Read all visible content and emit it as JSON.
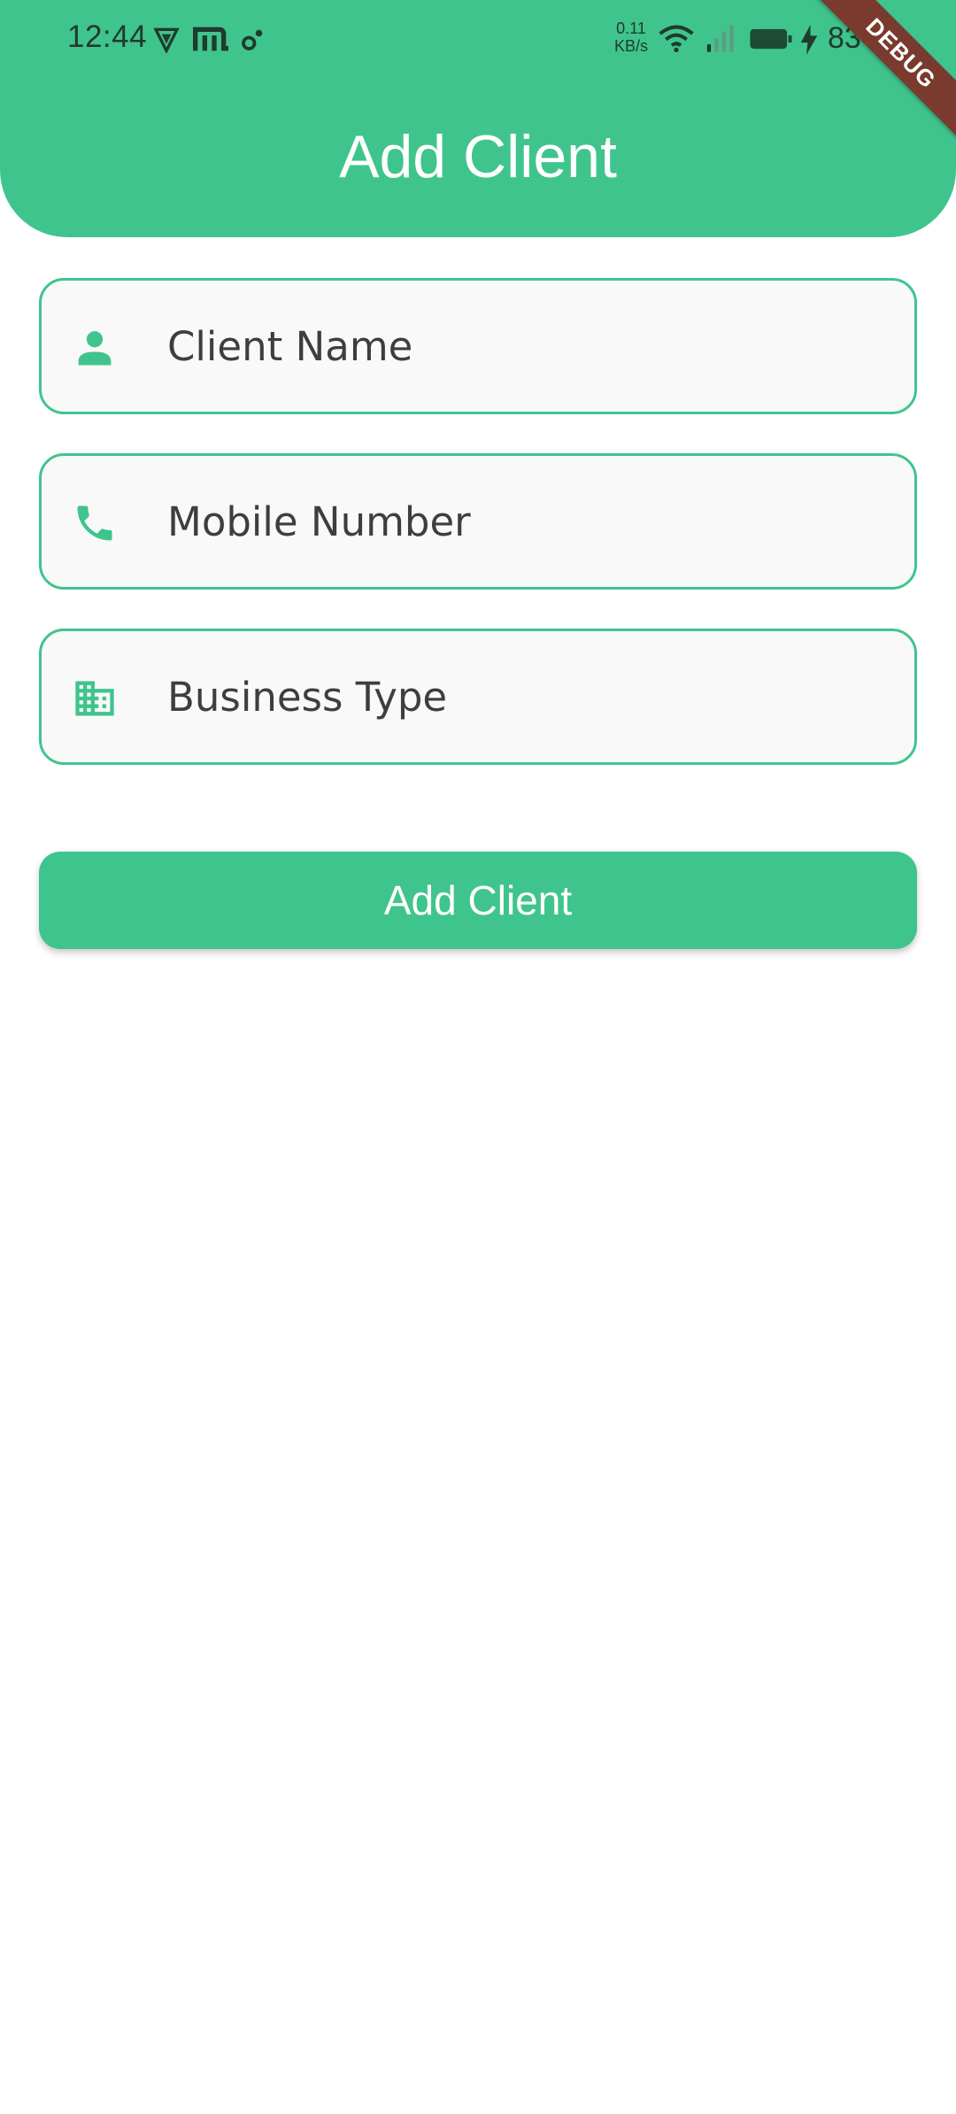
{
  "status_bar": {
    "time": "12:44",
    "network_speed": "0.11\nKB/s",
    "battery_percent": "83"
  },
  "header": {
    "title": "Add Client"
  },
  "debug_banner": "DEBUG",
  "form": {
    "fields": [
      {
        "icon": "person-icon",
        "placeholder": "Client Name",
        "value": ""
      },
      {
        "icon": "phone-icon",
        "placeholder": "Mobile Number",
        "value": ""
      },
      {
        "icon": "business-icon",
        "placeholder": "Business Type",
        "value": ""
      }
    ],
    "submit_label": "Add Client"
  },
  "colors": {
    "accent": "#40c48d",
    "field_background": "#f9f9f9",
    "text": "#3e3e3e",
    "debug_ribbon": "#7a3a2e"
  }
}
